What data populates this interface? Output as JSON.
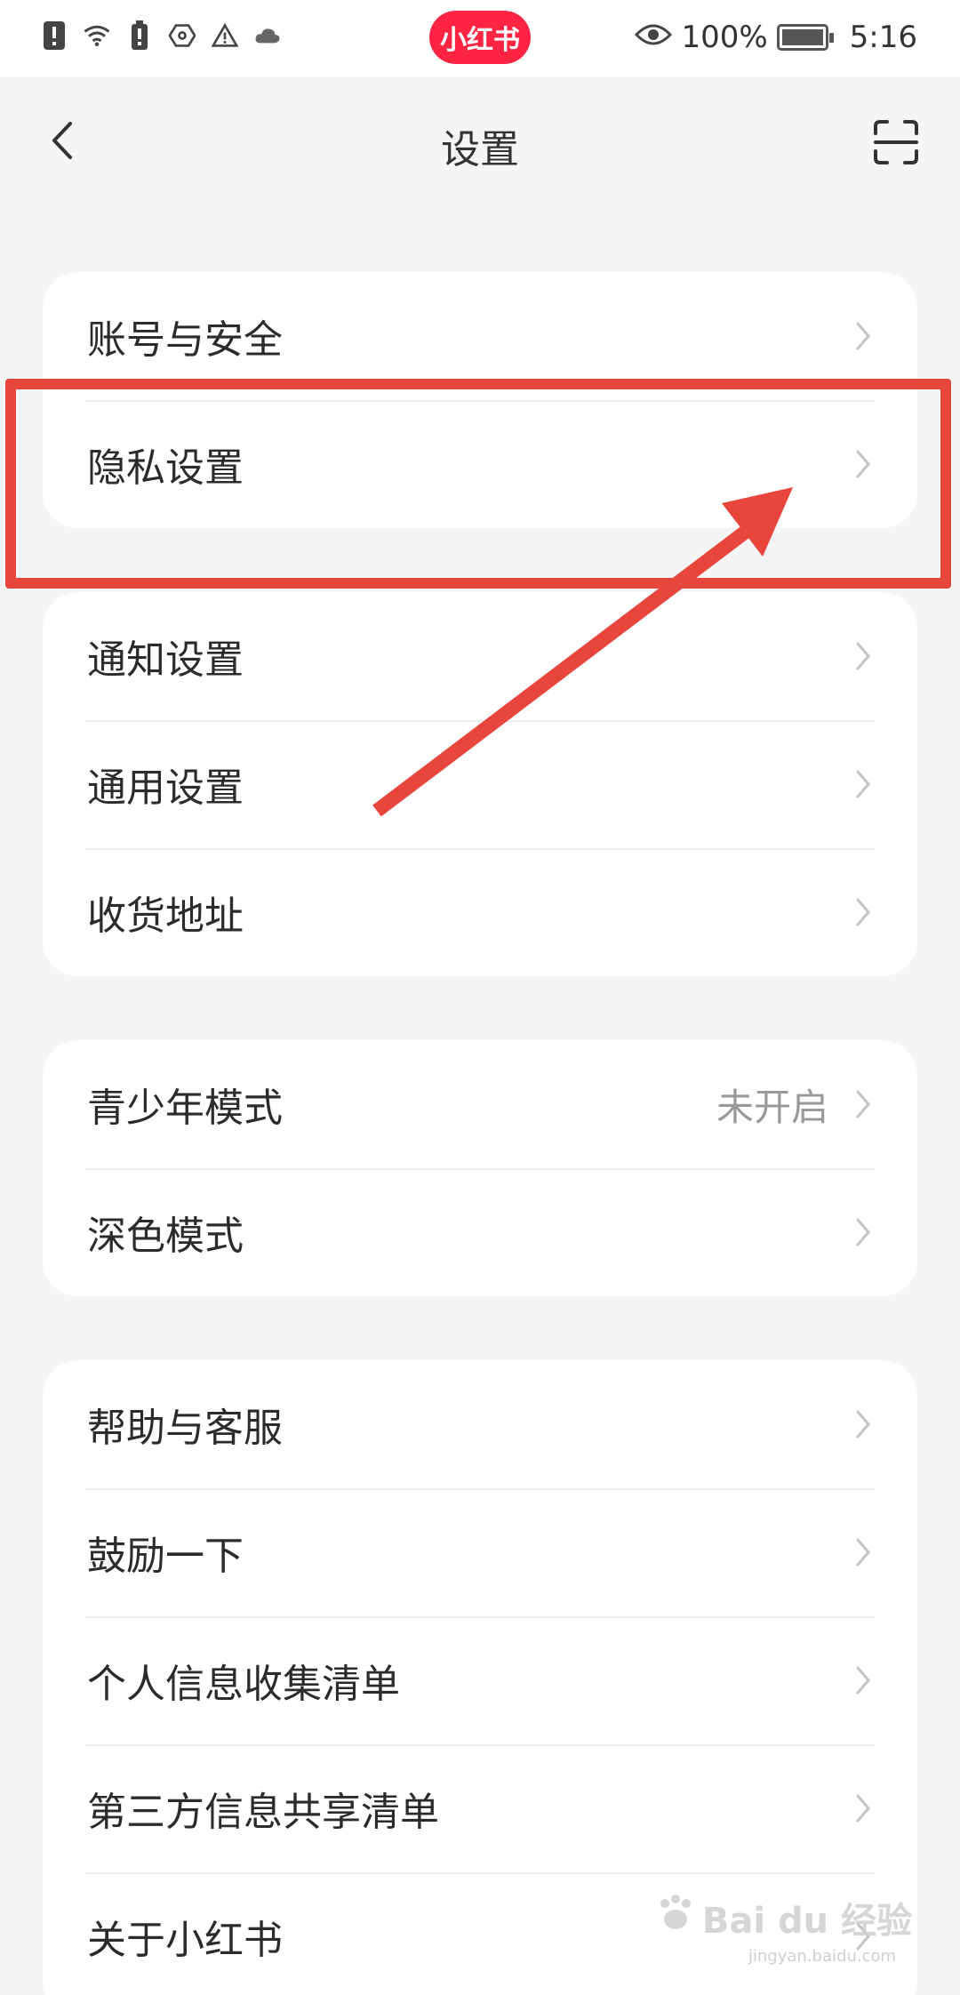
{
  "status_bar": {
    "app_badge": "小红书",
    "battery_percent": "100%",
    "time": "5:16",
    "left_icons": [
      "alert-icon",
      "wifi-icon",
      "battery-saver-icon",
      "nfc-icon",
      "warning-icon",
      "cloud-icon"
    ]
  },
  "header": {
    "title": "设置",
    "back_icon": "chevron-left-icon",
    "scan_icon": "scan-icon"
  },
  "groups": [
    {
      "items": [
        {
          "label": "账号与安全"
        },
        {
          "label": "隐私设置"
        }
      ]
    },
    {
      "items": [
        {
          "label": "通知设置"
        },
        {
          "label": "通用设置"
        },
        {
          "label": "收货地址"
        }
      ]
    },
    {
      "items": [
        {
          "label": "青少年模式",
          "value": "未开启"
        },
        {
          "label": "深色模式"
        }
      ]
    },
    {
      "items": [
        {
          "label": "帮助与客服"
        },
        {
          "label": "鼓励一下"
        },
        {
          "label": "个人信息收集清单"
        },
        {
          "label": "第三方信息共享清单"
        },
        {
          "label": "关于小红书"
        }
      ]
    }
  ],
  "watermark": {
    "text": "Bai du 经验",
    "sub": "jingyan.baidu.com"
  },
  "colors": {
    "brand": "#ff2442",
    "annotation": "#e8453c",
    "background": "#f5f5f5"
  }
}
